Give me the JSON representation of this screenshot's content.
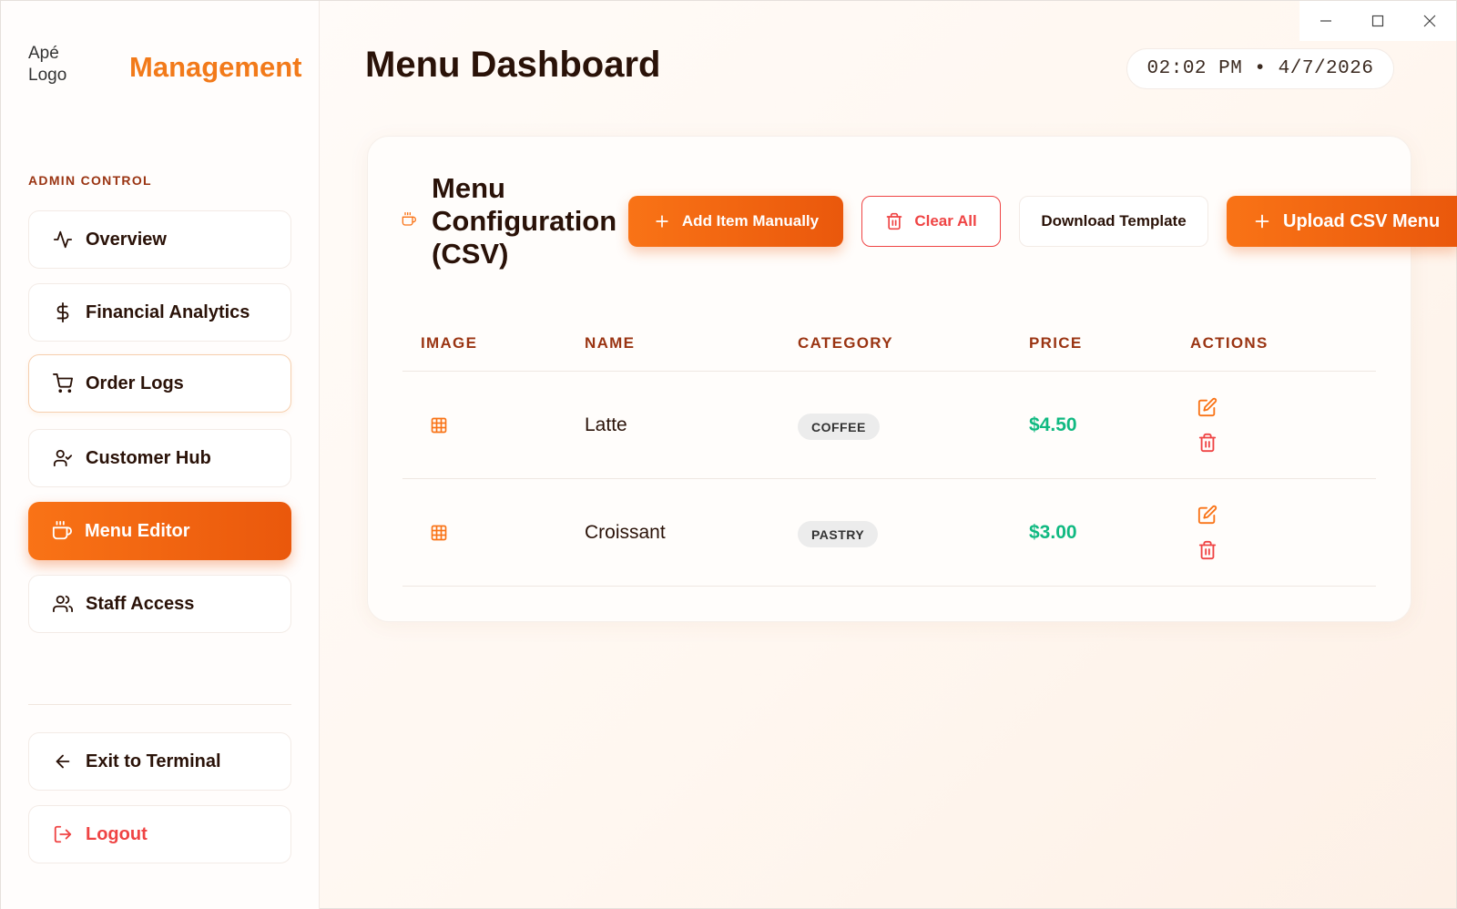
{
  "sidebar": {
    "logo_alt": "Apé Logo",
    "brand_title": "Management",
    "section_label": "ADMIN CONTROL",
    "items": [
      {
        "label": "Overview",
        "icon": "activity-icon"
      },
      {
        "label": "Financial Analytics",
        "icon": "dollar-icon"
      },
      {
        "label": "Order Logs",
        "icon": "cart-icon"
      },
      {
        "label": "Customer Hub",
        "icon": "user-check-icon"
      },
      {
        "label": "Menu Editor",
        "icon": "coffee-icon",
        "active": true
      },
      {
        "label": "Staff Access",
        "icon": "users-icon"
      }
    ],
    "footer": [
      {
        "label": "Exit to Terminal",
        "icon": "arrow-left-icon"
      },
      {
        "label": "Logout",
        "icon": "logout-icon"
      }
    ]
  },
  "header": {
    "title": "Menu Dashboard",
    "clock": "02:02 PM • 4/7/2026"
  },
  "card": {
    "title": "Menu Configuration (CSV)",
    "buttons": {
      "add": "Add Item Manually",
      "clear": "Clear All",
      "download": "Download Template",
      "upload": "Upload CSV Menu"
    },
    "columns": [
      "IMAGE",
      "NAME",
      "CATEGORY",
      "PRICE",
      "ACTIONS"
    ],
    "rows": [
      {
        "name": "Latte",
        "category": "COFFEE",
        "price": "$4.50"
      },
      {
        "name": "Croissant",
        "category": "PASTRY",
        "price": "$3.00"
      }
    ]
  },
  "colors": {
    "accent": "#f97316",
    "accent_dark": "#ea580c",
    "heading": "#2a1208",
    "section": "#9a3412",
    "price": "#10b981",
    "danger": "#ef4444"
  }
}
